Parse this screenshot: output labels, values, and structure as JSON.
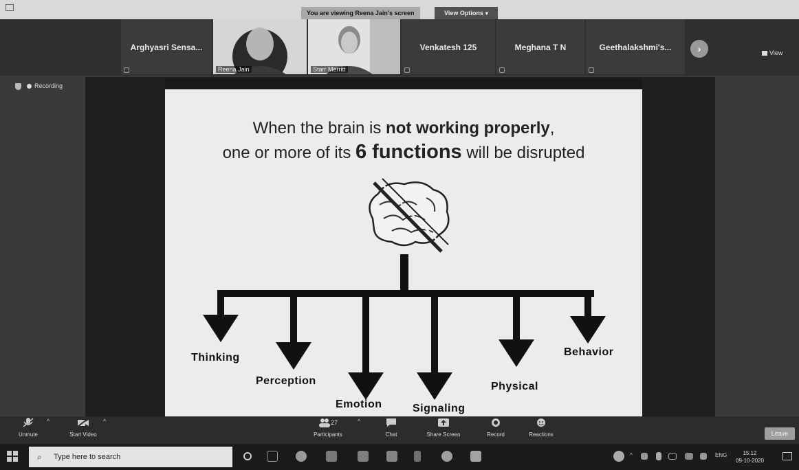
{
  "banner": {
    "viewing_text": "You are viewing Reena Jain's screen",
    "view_options_label": "View Options"
  },
  "participants": {
    "tiles": [
      {
        "name": "Arghyasri Sensa..."
      },
      {
        "name": "Venkatesh 125"
      },
      {
        "name": "Meghana T N"
      },
      {
        "name": "Geethalakshmi's..."
      }
    ],
    "videos": [
      {
        "label": "Reena Jain"
      },
      {
        "label": "Starr Merritt"
      }
    ],
    "view_label": "View"
  },
  "recording": {
    "label": "Recording"
  },
  "slide": {
    "line1_pre": "When the brain is ",
    "line1_bold": "not working properly",
    "line1_post": ",",
    "line2_pre": "one or more of its ",
    "line2_bold": "6 functions",
    "line2_post": " will be disrupted",
    "functions": [
      "Thinking",
      "Perception",
      "Emotion",
      "Signaling",
      "Physical",
      "Behavior"
    ]
  },
  "controls": {
    "unmute": "Unmute",
    "start_video": "Start Video",
    "participants": "Participants",
    "participants_count": "27",
    "chat": "Chat",
    "share_screen": "Share Screen",
    "record": "Record",
    "reactions": "Reactions",
    "leave": "Leave"
  },
  "taskbar": {
    "search_placeholder": "Type here to search",
    "lang": "ENG",
    "time": "15:12",
    "date": "09-10-2020"
  },
  "colors": {
    "slide_bg": "#ececec",
    "arrow": "#111111",
    "toolbar": "#2c2c2c"
  }
}
